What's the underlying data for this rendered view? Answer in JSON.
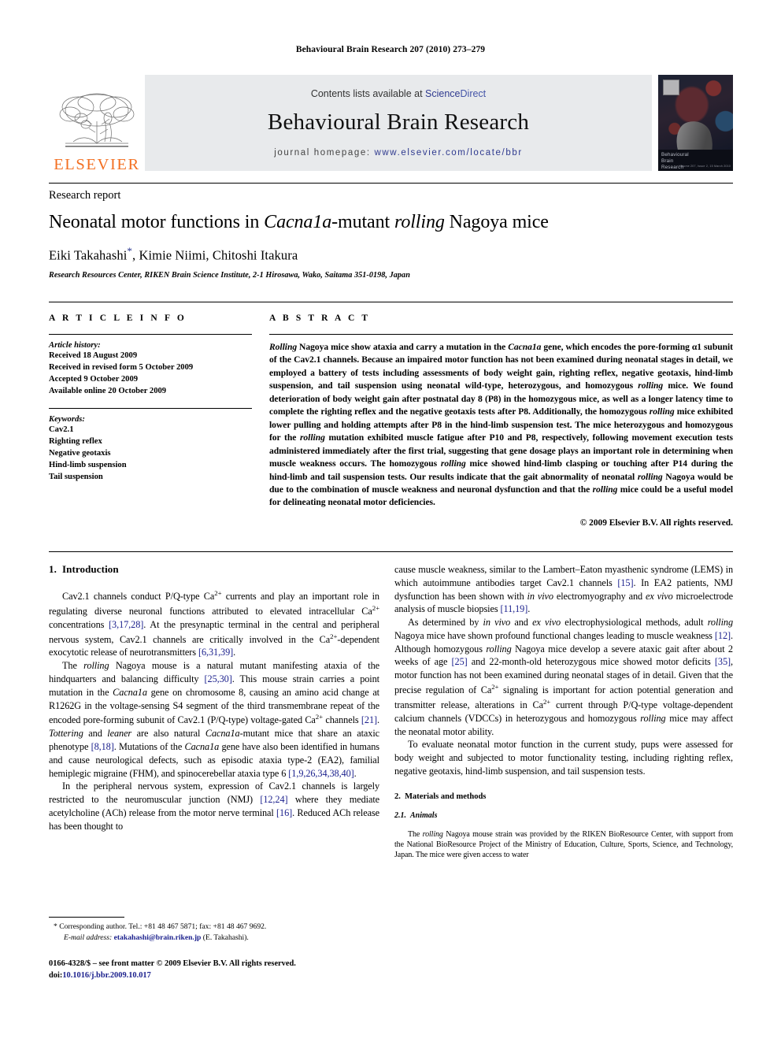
{
  "running_head": "Behavioural Brain Research 207 (2010) 273–279",
  "masthead": {
    "elsevier_wordmark": "ELSEVIER",
    "contents_prefix": "Contents lists available at ",
    "contents_link_science": "Science",
    "contents_link_direct": "Direct",
    "journal_title": "Behavioural Brain Research",
    "homepage_prefix": "journal homepage: ",
    "homepage_url": "www.elsevier.com/locate/bbr",
    "cover_caption_line1": "Behavioural",
    "cover_caption_line2": "Brain",
    "cover_caption_line3": "Research",
    "cover_issue": "Volume 207, Issue 2, 15 March 2010"
  },
  "title_block": {
    "section_type": "Research report",
    "title_part1": "Neonatal motor functions in ",
    "title_italic1": "Cacna1a",
    "title_part2": "-mutant ",
    "title_italic2": "rolling",
    "title_part3": " Nagoya mice",
    "authors": "Eiki Takahashi",
    "author_star": "*",
    "authors_rest": ", Kimie Niimi, Chitoshi Itakura",
    "affiliation": "Research Resources Center, RIKEN Brain Science Institute, 2-1 Hirosawa, Wako, Saitama 351-0198, Japan"
  },
  "article_info": {
    "heading": "A R T I C L E    I N F O",
    "history_label": "Article history:",
    "history": [
      "Received 18 August 2009",
      "Received in revised form 5 October 2009",
      "Accepted 9 October 2009",
      "Available online 20 October 2009"
    ],
    "keywords_label": "Keywords:",
    "keywords": [
      "Cav2.1",
      "Righting reflex",
      "Negative geotaxis",
      "Hind-limb suspension",
      "Tail suspension"
    ]
  },
  "abstract": {
    "heading": "A B S T R A C T",
    "text_segments": [
      {
        "i": true,
        "t": "Rolling"
      },
      {
        "i": false,
        "t": " Nagoya mice show ataxia and carry a mutation in the "
      },
      {
        "i": true,
        "t": "Cacna1a"
      },
      {
        "i": false,
        "t": " gene, which encodes the pore-forming α1 subunit of the Cav2.1 channels. Because an impaired motor function has not been examined during neonatal stages in detail, we employed a battery of tests including assessments of body weight gain, righting reflex, negative geotaxis, hind-limb suspension, and tail suspension using neonatal wild-type, heterozygous, and homozygous "
      },
      {
        "i": true,
        "t": "rolling"
      },
      {
        "i": false,
        "t": " mice. We found deterioration of body weight gain after postnatal day 8 (P8) in the homozygous mice, as well as a longer latency time to complete the righting reflex and the negative geotaxis tests after P8. Additionally, the homozygous "
      },
      {
        "i": true,
        "t": "rolling"
      },
      {
        "i": false,
        "t": " mice exhibited lower pulling and holding attempts after P8 in the hind-limb suspension test. The mice heterozygous and homozygous for the "
      },
      {
        "i": true,
        "t": "rolling"
      },
      {
        "i": false,
        "t": " mutation exhibited muscle fatigue after P10 and P8, respectively, following movement execution tests administered immediately after the first trial, suggesting that gene dosage plays an important role in determining when muscle weakness occurs. The homozygous "
      },
      {
        "i": true,
        "t": "rolling"
      },
      {
        "i": false,
        "t": " mice showed hind-limb clasping or touching after P14 during the hind-limb and tail suspension tests. Our results indicate that the gait abnormality of neonatal "
      },
      {
        "i": true,
        "t": "rolling"
      },
      {
        "i": false,
        "t": " Nagoya would be due to the combination of muscle weakness and neuronal dysfunction and that the "
      },
      {
        "i": true,
        "t": "rolling"
      },
      {
        "i": false,
        "t": " mice could be a useful model for delineating neonatal motor deficiencies."
      }
    ],
    "copyright": "© 2009 Elsevier B.V. All rights reserved."
  },
  "body": {
    "intro_number": "1.",
    "intro_heading": "Introduction",
    "methods_number": "2.",
    "methods_heading": "Materials and methods",
    "animals_number": "2.1.",
    "animals_heading": "Animals",
    "paragraphs_left": [
      [
        {
          "t": "Cav2.1 channels conduct P/Q-type Ca"
        },
        {
          "sup": "2+"
        },
        {
          "t": " currents and play an important role in regulating diverse neuronal functions attributed to elevated intracellular Ca"
        },
        {
          "sup": "2+"
        },
        {
          "t": " concentrations "
        },
        {
          "ref": "[3,17,28]"
        },
        {
          "t": ". At the presynaptic terminal in the central and peripheral nervous system, Cav2.1 channels are critically involved in the Ca"
        },
        {
          "sup": "2+"
        },
        {
          "t": "-dependent exocytotic release of neurotransmitters "
        },
        {
          "ref": "[6,31,39]"
        },
        {
          "t": "."
        }
      ],
      [
        {
          "t": "The "
        },
        {
          "i": "rolling"
        },
        {
          "t": " Nagoya mouse is a natural mutant manifesting ataxia of the hindquarters and balancing difficulty "
        },
        {
          "ref": "[25,30]"
        },
        {
          "t": ". This mouse strain carries a point mutation in the "
        },
        {
          "i": "Cacna1a"
        },
        {
          "t": " gene on chromosome 8, causing an amino acid change at R1262G in the voltage-sensing S4 segment of the third transmembrane repeat of the encoded pore-forming subunit of Cav2.1 (P/Q-type) voltage-gated Ca"
        },
        {
          "sup": "2+"
        },
        {
          "t": " channels "
        },
        {
          "ref": "[21]"
        },
        {
          "t": ". "
        },
        {
          "i": "Tottering"
        },
        {
          "t": " and "
        },
        {
          "i": "leaner"
        },
        {
          "t": " are also natural "
        },
        {
          "i": "Cacna1a"
        },
        {
          "t": "-mutant mice that share an ataxic phenotype "
        },
        {
          "ref": "[8,18]"
        },
        {
          "t": ". Mutations of the "
        },
        {
          "i": "Cacna1a"
        },
        {
          "t": " gene have also been identified in humans and cause neurological defects, such as episodic ataxia type-2 (EA2), familial hemiplegic migraine (FHM), and spinocerebellar ataxia type 6 "
        },
        {
          "ref": "[1,9,26,34,38,40]"
        },
        {
          "t": "."
        }
      ],
      [
        {
          "t": "In the peripheral nervous system, expression of Cav2.1 channels is largely restricted to the neuromuscular junction (NMJ) "
        },
        {
          "ref": "[12,24]"
        },
        {
          "t": " where they mediate acetylcholine (ACh) release from the motor nerve terminal "
        },
        {
          "ref": "[16]"
        },
        {
          "t": ". Reduced ACh release has been thought to"
        }
      ]
    ],
    "paragraphs_right": [
      [
        {
          "t": "cause muscle weakness, similar to the Lambert–Eaton myasthenic syndrome (LEMS) in which autoimmune antibodies target Cav2.1 channels "
        },
        {
          "ref": "[15]"
        },
        {
          "t": ". In EA2 patients, NMJ dysfunction has been shown with "
        },
        {
          "i": "in vivo"
        },
        {
          "t": " electromyography and "
        },
        {
          "i": "ex vivo"
        },
        {
          "t": " microelectrode analysis of muscle biopsies "
        },
        {
          "ref": "[11,19]"
        },
        {
          "t": "."
        }
      ],
      [
        {
          "t": "As determined by "
        },
        {
          "i": "in vivo"
        },
        {
          "t": " and "
        },
        {
          "i": "ex vivo"
        },
        {
          "t": " electrophysiological methods, adult "
        },
        {
          "i": "rolling"
        },
        {
          "t": " Nagoya mice have shown profound functional changes leading to muscle weakness "
        },
        {
          "ref": "[12]"
        },
        {
          "t": ". Although homozygous "
        },
        {
          "i": "rolling"
        },
        {
          "t": " Nagoya mice develop a severe ataxic gait after about 2 weeks of age "
        },
        {
          "ref": "[25]"
        },
        {
          "t": " and 22-month-old heterozygous mice showed motor deficits "
        },
        {
          "ref": "[35]"
        },
        {
          "t": ", motor function has not been examined during neonatal stages of in detail. Given that the precise regulation of Ca"
        },
        {
          "sup": "2+"
        },
        {
          "t": " signaling is important for action potential generation and transmitter release, alterations in Ca"
        },
        {
          "sup": "2+"
        },
        {
          "t": " current through P/Q-type voltage-dependent calcium channels (VDCCs) in heterozygous and homozygous "
        },
        {
          "i": "rolling"
        },
        {
          "t": " mice may affect the neonatal motor ability."
        }
      ],
      [
        {
          "t": "To evaluate neonatal motor function in the current study, pups were assessed for body weight and subjected to motor functionality testing, including righting reflex, negative geotaxis, hind-limb suspension, and tail suspension tests."
        }
      ]
    ],
    "paragraphs_methods": [
      [
        {
          "t": "The "
        },
        {
          "i": "rolling"
        },
        {
          "t": " Nagoya mouse strain was provided by the RIKEN BioResource Center, with support from the National BioResource Project of the Ministry of Education, Culture, Sports, Science, and Technology, Japan. The mice were given access to water"
        }
      ]
    ]
  },
  "footnote": {
    "star": "*",
    "corresponding": " Corresponding author. Tel.: +81 48 467 5871; fax: +81 48 467 9692.",
    "email_label": "E-mail address:",
    "email": "etakahashi@brain.riken.jp",
    "email_suffix": " (E. Takahashi)."
  },
  "issn": {
    "line1": "0166-4328/$ – see front matter © 2009 Elsevier B.V. All rights reserved.",
    "doi_label": "doi:",
    "doi_value": "10.1016/j.bbr.2009.10.017"
  },
  "colors": {
    "link": "#1a1f8c",
    "elsevier_orange": "#F36F21",
    "band_gray": "#e8eaec"
  }
}
